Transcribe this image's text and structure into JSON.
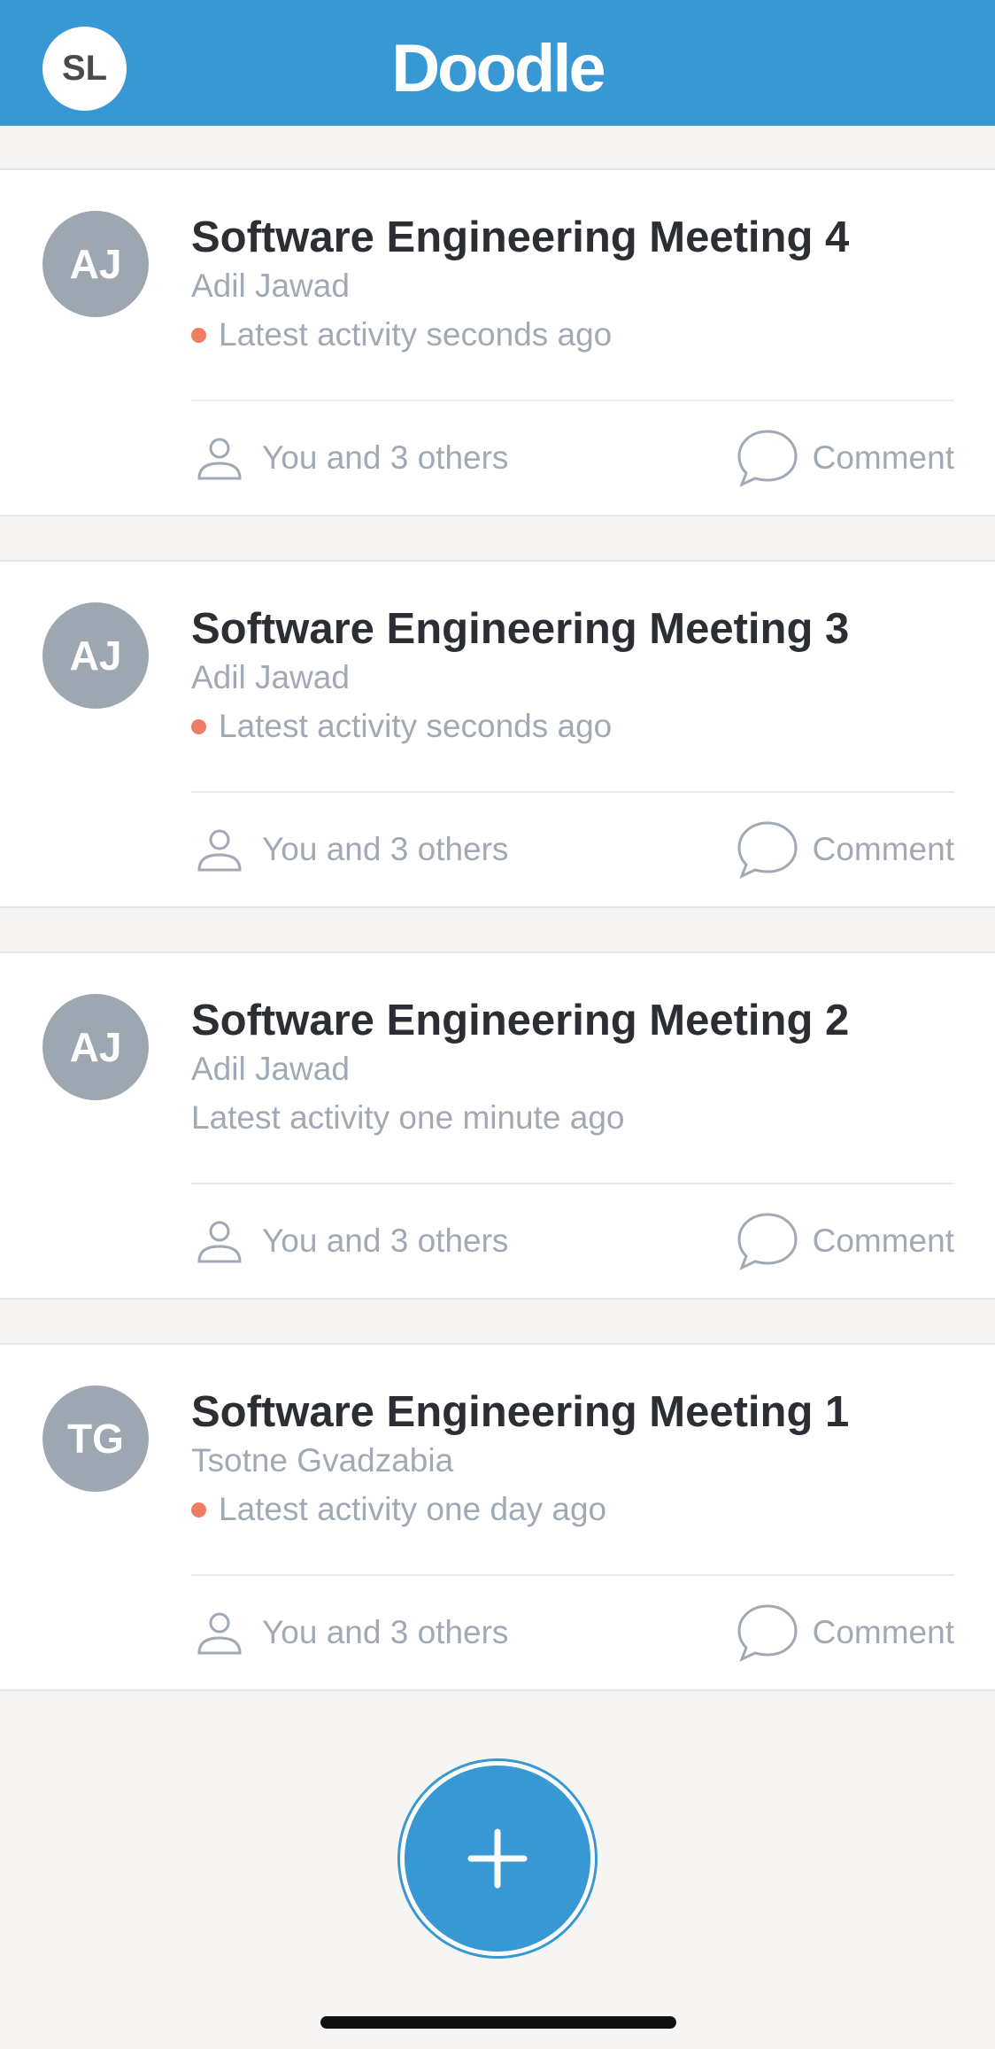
{
  "header": {
    "user_initials": "SL",
    "logo": "Doodle",
    "background_color": "#3798d4"
  },
  "polls": [
    {
      "title": "Software Engineering Meeting 4",
      "owner_initials": "AJ",
      "owner": "Adil Jawad",
      "activity": "Latest activity seconds ago",
      "unread": true,
      "participants": "You and 3 others",
      "comment_label": "Comment"
    },
    {
      "title": "Software Engineering Meeting 3",
      "owner_initials": "AJ",
      "owner": "Adil Jawad",
      "activity": "Latest activity seconds ago",
      "unread": true,
      "participants": "You and 3 others",
      "comment_label": "Comment"
    },
    {
      "title": "Software Engineering Meeting 2",
      "owner_initials": "AJ",
      "owner": "Adil Jawad",
      "activity": "Latest activity one minute ago",
      "unread": false,
      "participants": "You and 3 others",
      "comment_label": "Comment"
    },
    {
      "title": "Software Engineering Meeting 1",
      "owner_initials": "TG",
      "owner": "Tsotne Gvadzabia",
      "activity": "Latest activity one day ago",
      "unread": true,
      "participants": "You and 3 others",
      "comment_label": "Comment"
    }
  ],
  "icons": {
    "participants": "person-icon",
    "comment": "speech-bubble-icon",
    "fab": "plus-icon",
    "unread": "unread-dot-icon"
  },
  "colors": {
    "accent": "#3798d4",
    "unread_dot": "#ee7d63",
    "avatar": "#9ca7b2"
  }
}
